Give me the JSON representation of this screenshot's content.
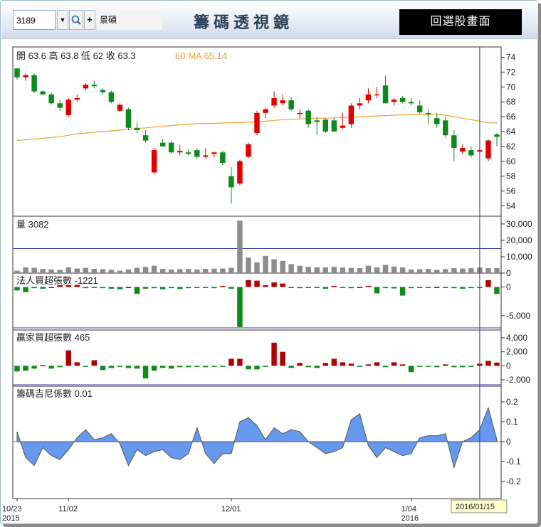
{
  "header": {
    "stock_code": "3189",
    "stock_name": "景碩",
    "title": "籌碼透視鏡",
    "back_button": "回選股畫面"
  },
  "colors": {
    "up": "#e00000",
    "down": "#0c8a1a",
    "ma": "#f0a030",
    "volume": "#8c8c8c",
    "gini": "#6699ee",
    "crosshair": "#3333aa"
  },
  "price_panel": {
    "ohlc_text": "開 63.6 高 63.8 低 62 收 63.3",
    "ma_text": "60 MA 65.14",
    "y_ticks": [
      "74",
      "72",
      "70",
      "68",
      "66",
      "64",
      "62",
      "60",
      "58",
      "56",
      "54"
    ]
  },
  "volume_panel": {
    "label": "量 3082",
    "y_ticks": [
      "30,000",
      "20,000",
      "10,000",
      "0"
    ]
  },
  "inst_panel": {
    "label": "法人買超張數 -1221",
    "y_ticks": [
      "0",
      "-5,000"
    ]
  },
  "major_panel": {
    "label": "贏家買超張數 465",
    "y_ticks": [
      "4,000",
      "2,000",
      "0",
      "-2,000"
    ]
  },
  "gini_panel": {
    "label": "籌碼吉尼係數 0.01",
    "y_ticks": [
      "0.2",
      "0.1",
      "0",
      "-0.1",
      "-0.2"
    ]
  },
  "x_axis": {
    "labels": [
      {
        "text": "10/23",
        "index": 0
      },
      {
        "text": "11/02",
        "index": 6
      },
      {
        "text": "12/01",
        "index": 25
      },
      {
        "text": "1/04",
        "index": 46
      }
    ],
    "years": [
      {
        "text": "2015",
        "index": 0
      },
      {
        "text": "2016",
        "index": 46
      }
    ],
    "cursor_date": "2016/01/15",
    "cursor_index": 54
  },
  "chart_data": {
    "type": "candlestick",
    "n": 55,
    "price_range": [
      53,
      75
    ],
    "candles": [
      [
        72.5,
        72.5,
        71.0,
        71.3
      ],
      [
        71.3,
        71.8,
        70.8,
        71.6
      ],
      [
        71.6,
        71.8,
        69.2,
        69.4
      ],
      [
        69.4,
        69.6,
        68.9,
        69.0
      ],
      [
        69.0,
        69.2,
        67.6,
        67.8
      ],
      [
        67.8,
        68.3,
        66.8,
        67.2
      ],
      [
        66.2,
        68.5,
        66.0,
        68.3
      ],
      [
        68.3,
        69.0,
        68.0,
        68.5
      ],
      [
        69.8,
        70.5,
        69.6,
        70.3
      ],
      [
        70.3,
        70.8,
        69.8,
        70.1
      ],
      [
        69.6,
        69.8,
        69.0,
        69.3
      ],
      [
        69.3,
        69.5,
        67.8,
        68.0
      ],
      [
        66.8,
        67.8,
        66.6,
        67.6
      ],
      [
        67.0,
        67.2,
        64.2,
        64.5
      ],
      [
        64.5,
        65.2,
        63.8,
        64.2
      ],
      [
        63.5,
        64.2,
        62.5,
        62.8
      ],
      [
        58.5,
        61.8,
        58.3,
        61.5
      ],
      [
        62.5,
        63.0,
        62.0,
        62.0
      ],
      [
        62.5,
        62.7,
        61.0,
        61.2
      ],
      [
        61.2,
        62.2,
        60.8,
        61.4
      ],
      [
        61.2,
        61.6,
        60.8,
        61.0
      ],
      [
        61.5,
        61.8,
        60.3,
        60.6
      ],
      [
        60.6,
        61.8,
        60.4,
        60.8
      ],
      [
        61.0,
        61.3,
        60.5,
        61.2
      ],
      [
        61.2,
        61.4,
        59.5,
        59.8
      ],
      [
        58.0,
        59.2,
        54.3,
        56.5
      ],
      [
        57.0,
        60.2,
        56.8,
        60.0
      ],
      [
        60.6,
        62.5,
        60.4,
        62.3
      ],
      [
        63.8,
        66.8,
        63.5,
        66.5
      ],
      [
        66.5,
        67.2,
        65.8,
        67.0
      ],
      [
        67.5,
        69.4,
        67.2,
        68.5
      ],
      [
        67.8,
        69.0,
        67.5,
        68.2
      ],
      [
        68.2,
        68.6,
        66.8,
        67.0
      ],
      [
        66.5,
        67.0,
        65.8,
        66.5
      ],
      [
        66.8,
        67.0,
        64.5,
        65.0
      ],
      [
        65.5,
        66.0,
        63.5,
        65.3
      ],
      [
        65.6,
        65.8,
        63.8,
        64.0
      ],
      [
        65.5,
        65.8,
        64.0,
        64.0
      ],
      [
        64.5,
        66.5,
        64.3,
        64.8
      ],
      [
        65.0,
        67.8,
        64.5,
        67.5
      ],
      [
        67.5,
        68.5,
        67.0,
        67.8
      ],
      [
        68.2,
        69.8,
        67.8,
        69.0
      ],
      [
        69.0,
        70.0,
        68.5,
        69.0
      ],
      [
        70.2,
        71.5,
        67.8,
        67.8
      ],
      [
        68.0,
        68.5,
        67.5,
        68.3
      ],
      [
        68.5,
        68.8,
        67.8,
        68.0
      ],
      [
        68.0,
        68.5,
        67.5,
        67.8
      ],
      [
        67.5,
        68.2,
        66.4,
        66.6
      ],
      [
        66.5,
        67.0,
        65.0,
        66.4
      ],
      [
        65.8,
        66.5,
        64.5,
        65.0
      ],
      [
        65.5,
        66.0,
        63.2,
        63.5
      ],
      [
        63.5,
        64.2,
        60.0,
        61.8
      ],
      [
        61.3,
        62.3,
        61.0,
        61.8
      ],
      [
        61.5,
        62.0,
        60.5,
        60.8
      ],
      [
        61.3,
        62.0,
        61.0,
        61.5
      ],
      [
        60.4,
        63.0,
        60.0,
        62.8
      ],
      [
        63.6,
        63.8,
        62.0,
        63.3
      ]
    ],
    "ma60": [
      62.8,
      62.9,
      63.0,
      63.1,
      63.2,
      63.3,
      63.5,
      63.7,
      63.8,
      63.9,
      64.0,
      64.1,
      64.2,
      64.3,
      64.4,
      64.5,
      64.6,
      64.7,
      64.8,
      64.9,
      65.0,
      65.05,
      65.1,
      65.1,
      65.15,
      65.2,
      65.2,
      65.25,
      65.3,
      65.4,
      65.5,
      65.6,
      65.65,
      65.7,
      65.75,
      65.8,
      65.8,
      65.85,
      65.9,
      65.95,
      66.0,
      66.05,
      66.1,
      66.15,
      66.2,
      66.25,
      66.25,
      66.3,
      66.3,
      66.3,
      66.2,
      66.0,
      65.8,
      65.6,
      65.4,
      65.2,
      65.14
    ],
    "volume": [
      1500,
      3500,
      3200,
      2500,
      2200,
      2000,
      3500,
      2800,
      3200,
      2600,
      2400,
      2000,
      1500,
      2200,
      3200,
      3800,
      4500,
      2600,
      2200,
      2400,
      2500,
      2200,
      2600,
      2700,
      2800,
      3200,
      32000,
      9500,
      6500,
      10500,
      8500,
      7500,
      5500,
      4500,
      3800,
      3600,
      3500,
      3800,
      3400,
      3200,
      3000,
      4500,
      3500,
      5000,
      4000,
      3500,
      2200,
      2400,
      2600,
      2000,
      2400,
      3000,
      2800,
      3000,
      3400,
      3000,
      3082
    ],
    "inst_net": [
      -600,
      -900,
      -200,
      -300,
      0,
      300,
      300,
      350,
      -200,
      -100,
      -200,
      -300,
      -400,
      0,
      -1200,
      -300,
      -200,
      -400,
      -200,
      -350,
      -200,
      -100,
      -150,
      -200,
      200,
      -300,
      -7000,
      1200,
      1100,
      300,
      800,
      600,
      -100,
      -200,
      -150,
      -100,
      -300,
      200,
      -150,
      -200,
      0,
      200,
      -1100,
      -200,
      -250,
      -1500,
      -200,
      -150,
      -100,
      0,
      -100,
      -200,
      -300,
      -200,
      -100,
      1200,
      -1221
    ],
    "major_net": [
      -800,
      -700,
      -400,
      100,
      -400,
      -200,
      2200,
      500,
      -100,
      800,
      -600,
      -300,
      -100,
      -300,
      -400,
      -1800,
      -700,
      -300,
      -400,
      -200,
      -200,
      -100,
      -200,
      -100,
      -100,
      1000,
      1000,
      -500,
      -500,
      -100,
      3300,
      2000,
      -300,
      400,
      -200,
      -300,
      400,
      1000,
      500,
      300,
      -100,
      200,
      500,
      -200,
      500,
      200,
      -900,
      -100,
      -100,
      -200,
      200,
      -200,
      -200,
      -100,
      300,
      700,
      465
    ],
    "gini": [
      0.05,
      -0.08,
      -0.12,
      -0.03,
      -0.07,
      -0.09,
      -0.04,
      0.02,
      0.06,
      0.01,
      0.02,
      0.04,
      -0.01,
      -0.12,
      -0.04,
      -0.07,
      -0.05,
      -0.04,
      -0.08,
      -0.09,
      -0.06,
      0.07,
      -0.06,
      -0.11,
      -0.06,
      -0.06,
      0.1,
      0.12,
      0.08,
      0.01,
      0.07,
      0.04,
      0.06,
      0.05,
      0.0,
      -0.03,
      -0.06,
      -0.05,
      -0.03,
      0.11,
      0.14,
      -0.02,
      -0.08,
      -0.03,
      -0.05,
      -0.07,
      -0.06,
      0.02,
      0.03,
      0.03,
      0.04,
      -0.13,
      0.0,
      0.02,
      0.06,
      0.17,
      0.01
    ]
  }
}
